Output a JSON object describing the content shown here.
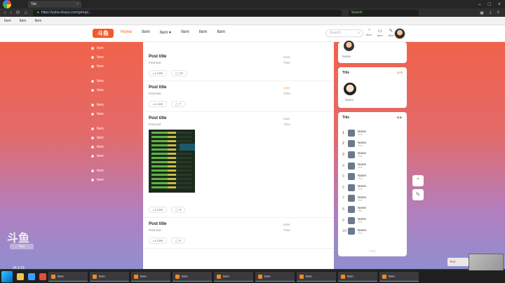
{
  "browser": {
    "tab_title": "Tab",
    "url": "https://yuba.douyu.com/group/...",
    "search_engine_text": "Search",
    "window_controls": [
      "–",
      "□",
      "×"
    ]
  },
  "bookmarks": [
    "Item",
    "Item",
    "Item"
  ],
  "site": {
    "logo_text": "斗鱼",
    "nav": [
      "Home",
      "Item",
      "Item ▾",
      "Item",
      "Item",
      "Item"
    ],
    "search_placeholder": "Search",
    "header_actions": [
      "Item",
      "Item",
      "Item"
    ]
  },
  "left_sidebar": {
    "group1": [
      "Item",
      "Item",
      "Item"
    ],
    "group2": [
      "Item",
      "Item"
    ],
    "group3": [
      "Item",
      "Item"
    ],
    "group4": [
      "Item",
      "Item",
      "Item",
      "Item"
    ],
    "group5": [
      "Item",
      "Item"
    ]
  },
  "feed": [
    {
      "title": "Post title",
      "subtitle": "Post text",
      "meta_user": "User",
      "meta_time": "Time",
      "likes_label": "Like",
      "comments_count": "10"
    },
    {
      "title": "Post title",
      "subtitle": "Post text",
      "meta_user": "User",
      "meta_time": "Time",
      "likes_label": "Like",
      "comments_count": "7"
    },
    {
      "title": "Post title",
      "subtitle": "Post text",
      "meta_user": "User",
      "meta_time": "Time",
      "likes_label": "Like",
      "comments_count": "6"
    },
    {
      "title": "Post title",
      "subtitle": "Post text",
      "meta_user": "User",
      "meta_time": "Time",
      "likes_label": "Like",
      "comments_count": "0"
    }
  ],
  "right": {
    "profile_name": "Name",
    "manager_title": "Title",
    "manager_link": "Link",
    "manager_name": "Name",
    "rank_title": "Title",
    "rank_ctrls": "◀ ▶",
    "rank_footer": "• • •",
    "ranks": [
      {
        "no": "1",
        "name": "Name",
        "sub": "Text"
      },
      {
        "no": "2",
        "name": "Name",
        "sub": "Text"
      },
      {
        "no": "3",
        "name": "Name",
        "sub": "Text"
      },
      {
        "no": "4",
        "name": "Name",
        "sub": "Text"
      },
      {
        "no": "5",
        "name": "Name",
        "sub": "Text"
      },
      {
        "no": "6",
        "name": "Name",
        "sub": "Text"
      },
      {
        "no": "7",
        "name": "Name",
        "sub": "Text"
      },
      {
        "no": "8",
        "name": "Name",
        "sub": "Text"
      },
      {
        "no": "9",
        "name": "Name",
        "sub": "Text"
      },
      {
        "no": "10",
        "name": "Name",
        "sub": "Text"
      }
    ]
  },
  "watermark": {
    "logo": "斗鱼",
    "tag": "Text"
  },
  "clock": "24:1:23",
  "notify": "Text",
  "taskbar": [
    "Item",
    "Item",
    "Item",
    "Item",
    "Item",
    "Item",
    "Item",
    "Item",
    "Item"
  ],
  "colors": {
    "accent": "#ff5d23",
    "bg_top": "#f0624a",
    "bg_bottom": "#8f8fd0"
  }
}
